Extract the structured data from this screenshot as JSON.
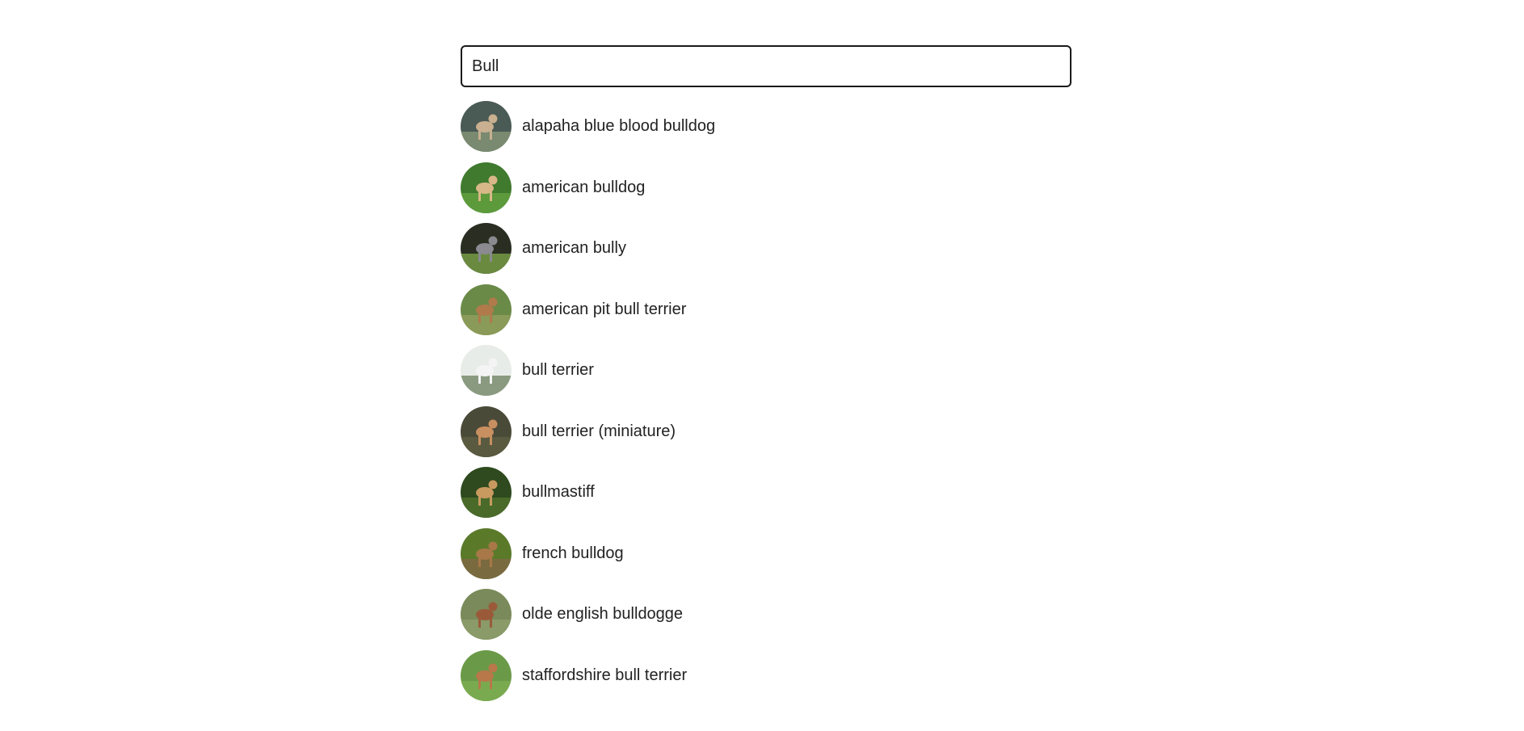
{
  "search": {
    "value": "Bull",
    "placeholder": ""
  },
  "results": [
    {
      "label": "alapaha blue blood bulldog",
      "image_icon": "dog-photo-icon",
      "bg": "#4a5a55",
      "ground": "#7a8a70",
      "dog": "#c8b090"
    },
    {
      "label": "american bulldog",
      "image_icon": "dog-photo-icon",
      "bg": "#3f7a2e",
      "ground": "#5c9a3c",
      "dog": "#d8b888"
    },
    {
      "label": "american bully",
      "image_icon": "dog-photo-icon",
      "bg": "#2a2e22",
      "ground": "#6a8a40",
      "dog": "#8a8a90"
    },
    {
      "label": "american pit bull terrier",
      "image_icon": "dog-photo-icon",
      "bg": "#6a8a48",
      "ground": "#8a9a58",
      "dog": "#b07a4a"
    },
    {
      "label": "bull terrier",
      "image_icon": "dog-photo-icon",
      "bg": "#e8ece8",
      "ground": "#8a9a80",
      "dog": "#f4f4f4"
    },
    {
      "label": "bull terrier (miniature)",
      "image_icon": "dog-photo-icon",
      "bg": "#4a4a38",
      "ground": "#5a5a40",
      "dog": "#c89060"
    },
    {
      "label": "bullmastiff",
      "image_icon": "dog-photo-icon",
      "bg": "#2e4a1e",
      "ground": "#4a6a2a",
      "dog": "#c89a60"
    },
    {
      "label": "french bulldog",
      "image_icon": "dog-photo-icon",
      "bg": "#5a7a2a",
      "ground": "#7a6a40",
      "dog": "#a87848"
    },
    {
      "label": "olde english bulldogge",
      "image_icon": "dog-photo-icon",
      "bg": "#7a8a5a",
      "ground": "#8a9a68",
      "dog": "#9a5a3a"
    },
    {
      "label": "staffordshire bull terrier",
      "image_icon": "dog-photo-icon",
      "bg": "#6a9a48",
      "ground": "#7aaa50",
      "dog": "#b8784a"
    }
  ]
}
